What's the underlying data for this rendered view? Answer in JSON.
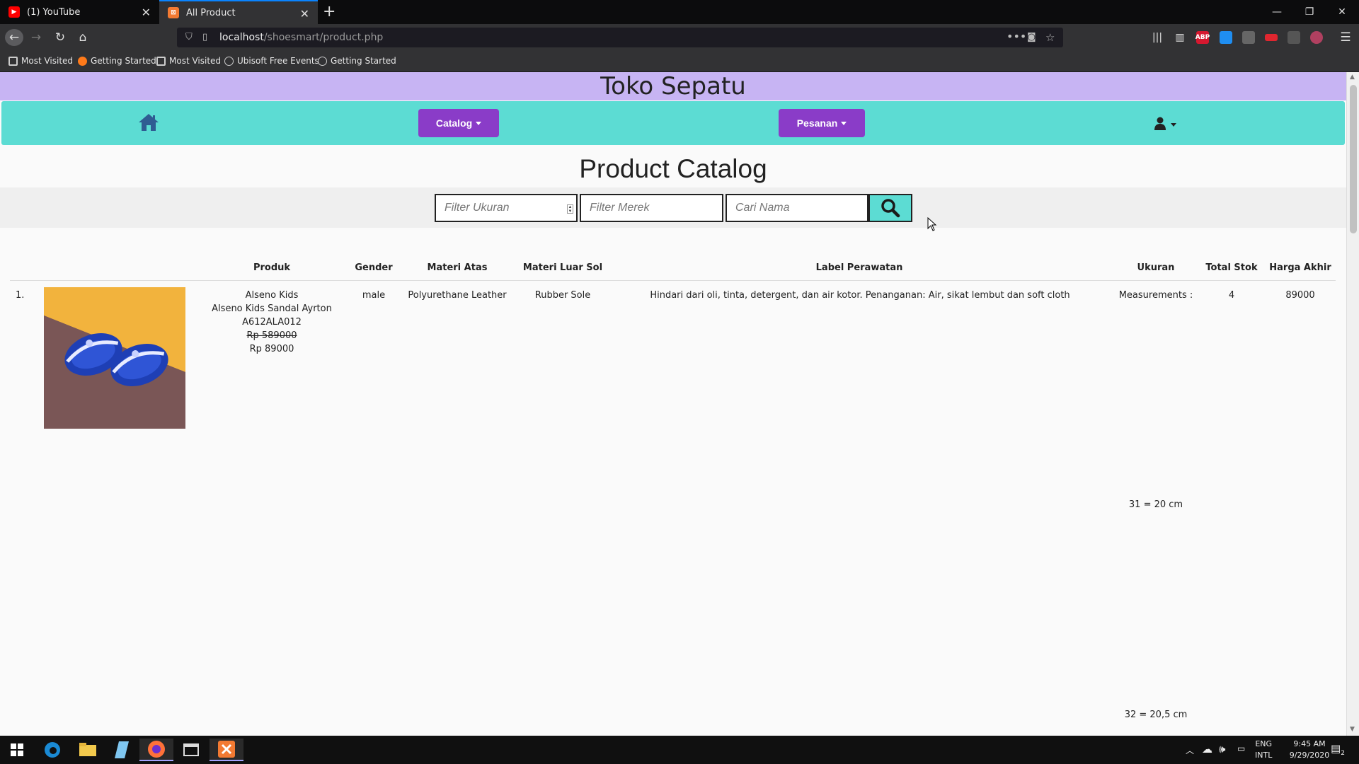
{
  "browser": {
    "tabs": [
      {
        "title": "(1) YouTube",
        "active": false
      },
      {
        "title": "All Product",
        "active": true
      }
    ],
    "url_host": "localhost",
    "url_path": "/shoesmart/product.php",
    "bookmarks": [
      "Most Visited",
      "Getting Started",
      "Most Visited",
      "Ubisoft Free Events",
      "Getting Started"
    ],
    "addons": [
      "ABP"
    ]
  },
  "site": {
    "title": "Toko Sepatu",
    "nav": {
      "catalog_label": "Catalog",
      "pesanan_label": "Pesanan"
    }
  },
  "catalog": {
    "title": "Product Catalog",
    "filters": {
      "size_placeholder": "Filter Ukuran",
      "brand_placeholder": "Filter Merek",
      "name_placeholder": "Cari Nama"
    },
    "columns": [
      "Produk",
      "Gender",
      "Materi Atas",
      "Materi Luar Sol",
      "Label Perawatan",
      "Ukuran",
      "Total Stok",
      "Harga Akhir"
    ],
    "rows": [
      {
        "no": "1.",
        "brand": "Alseno Kids",
        "name": "Alseno Kids Sandal Ayrton",
        "code": "A612ALA012",
        "old_price": "Rp 589000",
        "price": "Rp 89000",
        "gender": "male",
        "materi_atas": "Polyurethane Leather",
        "materi_sol": "Rubber Sole",
        "label_perawatan": "Hindari dari oli, tinta, detergent, dan air kotor. Penanganan: Air, sikat lembut dan soft cloth",
        "ukuran_header": "Measurements :",
        "ukuran": [
          "31 = 20 cm",
          "32 = 20,5 cm"
        ],
        "total_stok": "4",
        "harga_akhir": "89000"
      }
    ]
  },
  "taskbar": {
    "lang": "ENG",
    "layout": "INTL",
    "time": "9:45 AM",
    "date": "9/29/2020",
    "notifications": "2"
  },
  "colors": {
    "title_bg": "#c7b4f3",
    "nav_bg": "#5cdcd3",
    "button_bg": "#8a3cc8"
  }
}
